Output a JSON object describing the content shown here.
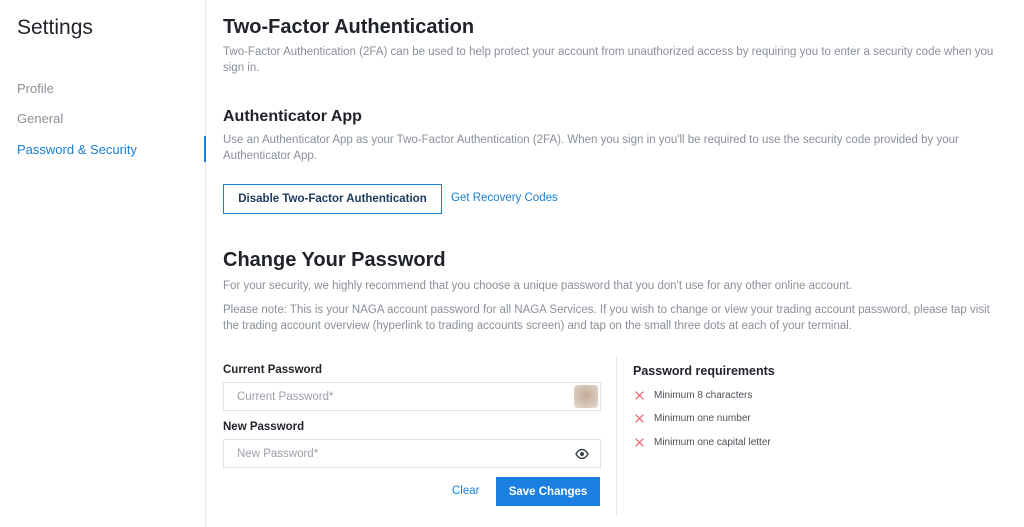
{
  "sidebar": {
    "title": "Settings",
    "items": [
      {
        "label": "Profile"
      },
      {
        "label": "General"
      },
      {
        "label": "Password & Security"
      }
    ]
  },
  "two_factor": {
    "title": "Two-Factor Authentication",
    "description": "Two-Factor Authentication (2FA) can be used to help protect your account from unauthorized access by requiring you to enter a security code when you sign in."
  },
  "authenticator": {
    "title": "Authenticator App",
    "description": "Use an Authenticator App as your Two-Factor Authentication (2FA). When you sign in you'll be required to use the security code provided by your Authenticator App.",
    "disable_button": "Disable Two-Factor Authentication",
    "recovery_link": "Get Recovery Codes"
  },
  "change_password": {
    "title": "Change Your Password",
    "intro": "For your security, we highly recommend that you choose a unique password that you don't use for any other online account.",
    "note": "Please note: This is your NAGA account password for all NAGA Services. If you wish to change or view your trading account password, please tap visit the trading account overview (hyperlink to trading accounts screen) and tap on the small three dots at each of your terminal.",
    "current_label": "Current Password",
    "current_placeholder": "Current Password*",
    "new_label": "New Password",
    "new_placeholder": "New Password*",
    "clear_label": "Clear",
    "save_label": "Save Changes"
  },
  "requirements": {
    "title": "Password requirements",
    "items": [
      {
        "label": "Minimum 8 characters",
        "status": "unmet"
      },
      {
        "label": "Minimum one number",
        "status": "unmet"
      },
      {
        "label": "Minimum one capital letter",
        "status": "unmet"
      }
    ]
  },
  "colors": {
    "accent": "#1a7fd4",
    "primary_button": "#1a7fe0",
    "error": "#e5514d",
    "muted_text": "#8a9099"
  },
  "icons": {
    "password_toggle": "eye-icon",
    "requirement_unmet": "close-icon"
  }
}
